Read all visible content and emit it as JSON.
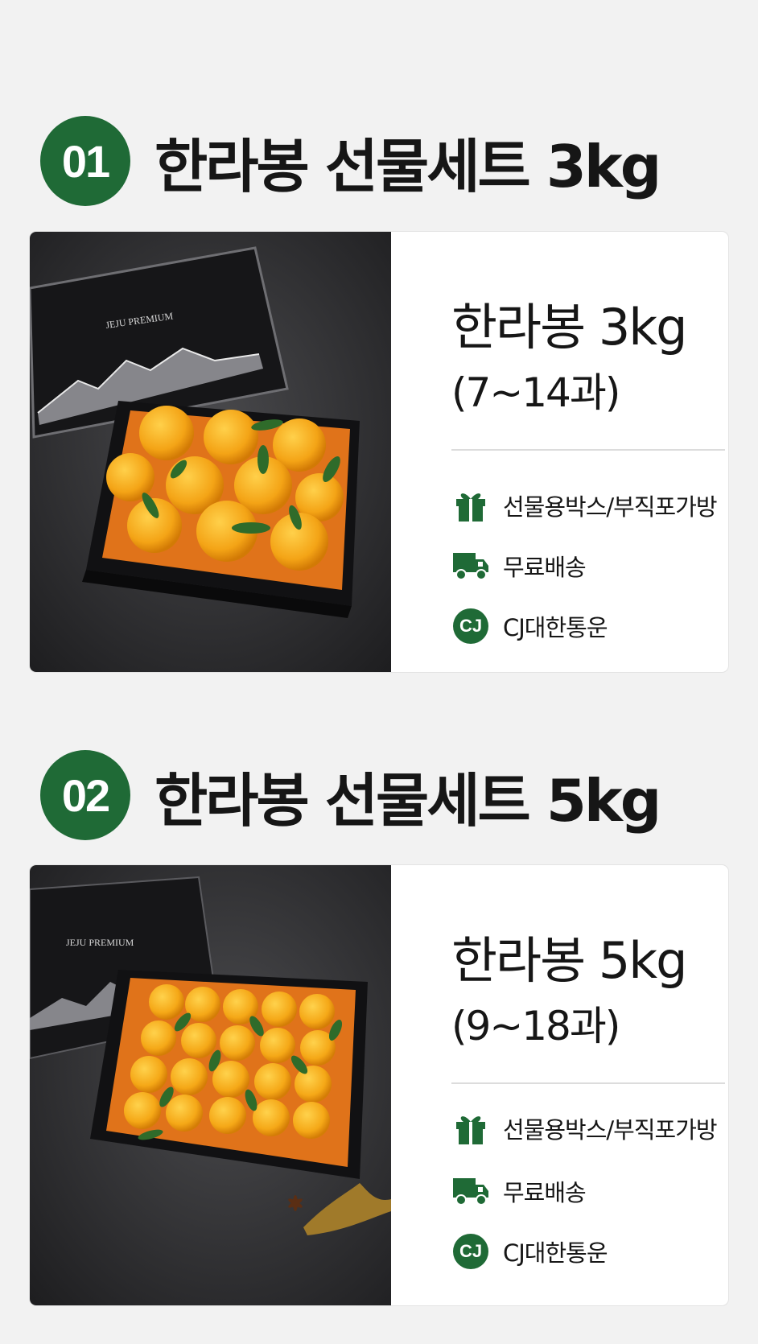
{
  "sets": [
    {
      "badge": "01",
      "title": "한라봉 선물세트 3kg",
      "product_name": "한라봉 3kg",
      "count": "(7~14과)",
      "box_label": "JEJU PREMIUM",
      "features": {
        "gift": "선물용박스/부직포가방",
        "shipping": "무료배송",
        "courier_icon": "CJ",
        "courier": "CJ대한통운"
      }
    },
    {
      "badge": "02",
      "title": "한라봉 선물세트 5kg",
      "product_name": "한라봉 5kg",
      "count": "(9~18과)",
      "box_label": "JEJU PREMIUM",
      "features": {
        "gift": "선물용박스/부직포가방",
        "shipping": "무료배송",
        "courier_icon": "CJ",
        "courier": "CJ대한통운"
      }
    }
  ],
  "colors": {
    "accent": "#1f6a36",
    "text": "#161616",
    "background": "#f2f2f2"
  },
  "icons": [
    "gift-icon",
    "delivery-truck-icon",
    "cj-logo-icon"
  ]
}
